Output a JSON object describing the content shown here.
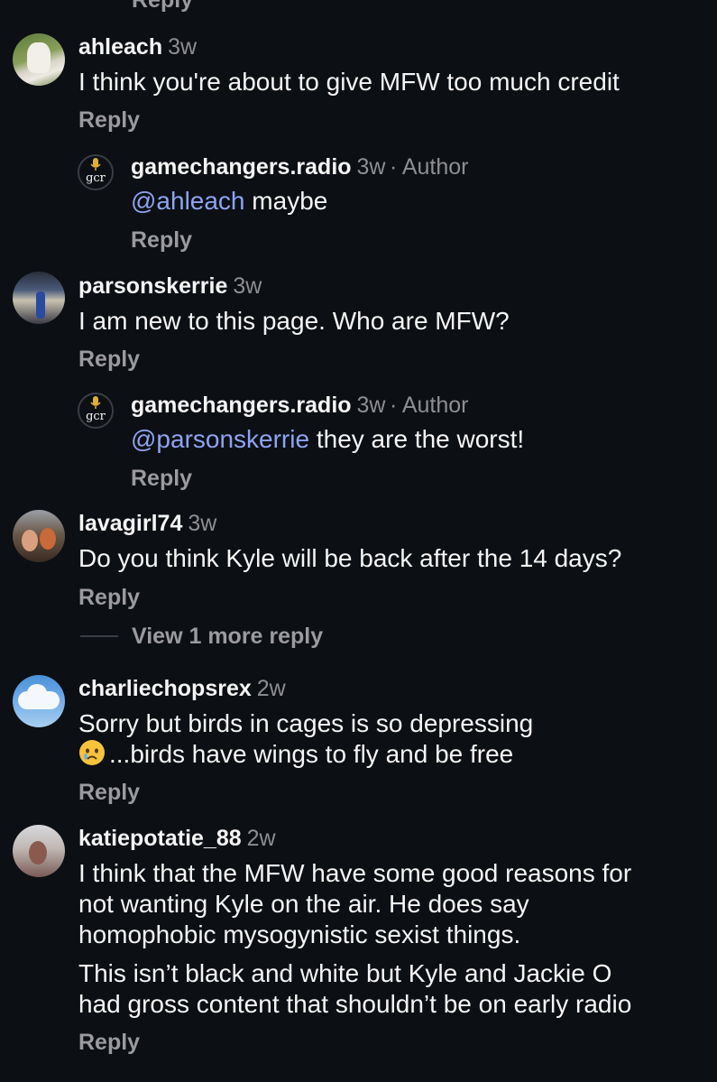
{
  "top_reply_label": "Reply",
  "comments": [
    {
      "username": "ahleach",
      "time": "3w",
      "text": "I think you're about to give MFW too much credit",
      "reply_label": "Reply"
    },
    {
      "username": "gamechangers.radio",
      "time": "3w",
      "badge": "· Author",
      "mention": "@ahleach",
      "text": " maybe",
      "reply_label": "Reply",
      "avatar_text": "gcr"
    },
    {
      "username": "parsonskerrie",
      "time": "3w",
      "text": "I am new to this page. Who are MFW?",
      "reply_label": "Reply"
    },
    {
      "username": "gamechangers.radio",
      "time": "3w",
      "badge": "· Author",
      "mention": "@parsonskerrie",
      "text": " they are the worst!",
      "reply_label": "Reply",
      "avatar_text": "gcr"
    },
    {
      "username": "lavagirl74",
      "time": "3w",
      "text": "Do you think Kyle will be back after the 14 days?",
      "reply_label": "Reply",
      "view_more": "View 1 more reply"
    },
    {
      "username": "charliechopsrex",
      "time": "2w",
      "text_lines": [
        "Sorry but birds in cages is so depressing",
        "...birds have wings to fly and be free"
      ],
      "emoji": "crying-face",
      "reply_label": "Reply"
    },
    {
      "username": "katiepotatie_88",
      "time": "2w",
      "text_lines": [
        "I think that the MFW have some good reasons for",
        "not wanting Kyle on the air. He does say",
        "homophobic mysogynistic sexist things.",
        "This isn’t black and white but Kyle and Jackie O",
        "had gross content that shouldn’t be on early radio"
      ],
      "reply_label": "Reply"
    }
  ],
  "colors": {
    "background": "#0c0f14",
    "primary_text": "#f5f5f5",
    "secondary_text": "#8e8e93",
    "mention": "#8ea4f2"
  }
}
